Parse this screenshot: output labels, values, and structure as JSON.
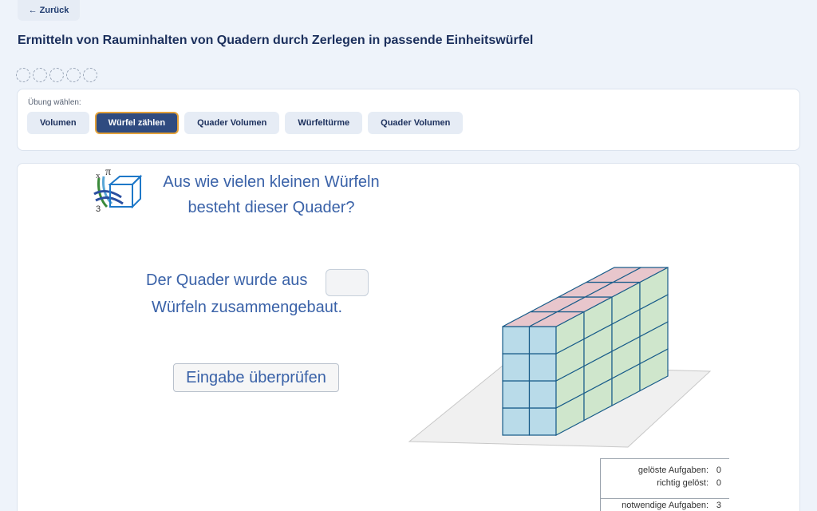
{
  "nav": {
    "back_label": "← Zurück"
  },
  "page": {
    "title": "Ermitteln von Rauminhalten von Quadern durch Zerlegen in passende Einheitswürfel"
  },
  "progress": {
    "total": 5,
    "completed": 0
  },
  "exercise_picker": {
    "label": "Übung wählen:",
    "tabs": [
      {
        "label": "Volumen",
        "active": false
      },
      {
        "label": "Würfel zählen",
        "active": true
      },
      {
        "label": "Quader Volumen",
        "active": false
      },
      {
        "label": "Würfeltürme",
        "active": false
      },
      {
        "label": "Quader Volumen",
        "active": false
      }
    ]
  },
  "task": {
    "question_line1": "Aus wie vielen kleinen Würfeln",
    "question_line2": "besteht dieser Quader?",
    "answer_prefix": "Der Quader wurde aus",
    "answer_value": "",
    "answer_suffix": "Würfeln zusammengebaut.",
    "check_button": "Eingabe überprüfen"
  },
  "logo": {
    "symbols": [
      "x",
      "π",
      "3"
    ]
  },
  "cuboid": {
    "width": 2,
    "height": 4,
    "depth": 4
  },
  "colors": {
    "front": "#b9dbe9",
    "side": "#cfe6cc",
    "top": "#e8c6cc",
    "edge": "#1a5d8a",
    "accent": "#e3a13a",
    "primary": "#2f4b80"
  },
  "stats": {
    "solved_label": "gelöste Aufgaben:",
    "solved_value": "0",
    "correct_label": "richtig gelöst:",
    "correct_value": "0",
    "required_label": "notwendige Aufgaben:",
    "required_value": "3"
  }
}
